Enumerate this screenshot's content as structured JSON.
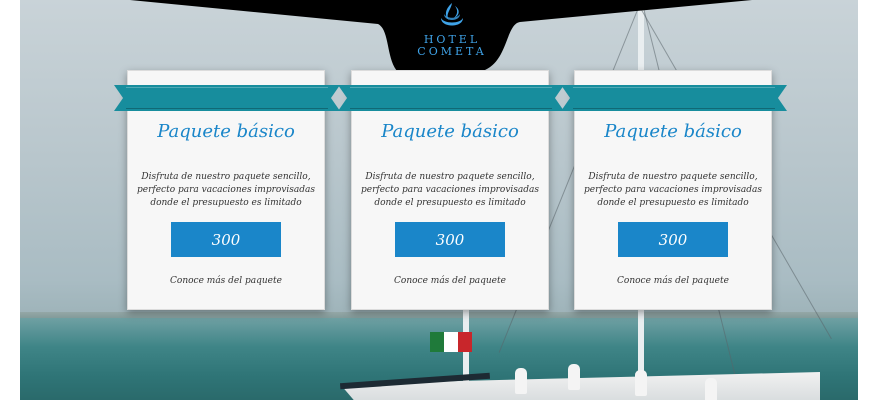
{
  "brand": {
    "line1": "HOTEL",
    "line2": "COMETA",
    "icon": "flame-swirl-icon",
    "color": "#3fa3e8"
  },
  "colors": {
    "ribbon": "#178d9d",
    "accent": "#1a86c9"
  },
  "flag_colors": [
    "#1f7a3a",
    "#ffffff",
    "#c8262b"
  ],
  "packages": [
    {
      "title": "Paquete básico",
      "description": "Disfruta de nuestro paquete sencillo, perfecto para vacaciones improvisadas donde el presupuesto es limitado",
      "price": "300",
      "link": "Conoce más del paquete"
    },
    {
      "title": "Paquete básico",
      "description": "Disfruta de nuestro paquete sencillo, perfecto para vacaciones improvisadas donde el presupuesto es limitado",
      "price": "300",
      "link": "Conoce más del paquete"
    },
    {
      "title": "Paquete básico",
      "description": "Disfruta de nuestro paquete sencillo, perfecto para vacaciones improvisadas donde el presupuesto es limitado",
      "price": "300",
      "link": "Conoce más del paquete"
    }
  ]
}
